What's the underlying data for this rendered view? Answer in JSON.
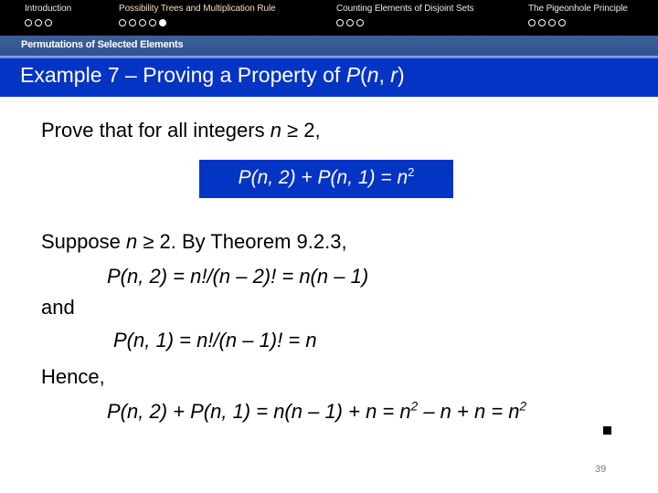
{
  "nav": {
    "sections": [
      {
        "title": "Introduction",
        "dots": [
          false,
          false,
          false
        ],
        "active": false
      },
      {
        "title": "Possibility Trees and Multiplication Rule",
        "dots": [
          false,
          false,
          false,
          false,
          true
        ],
        "active": true
      },
      {
        "title": "Counting Elements of Disjoint Sets",
        "dots": [
          false,
          false,
          false
        ],
        "active": false
      },
      {
        "title": "The Pigeonhole Principle",
        "dots": [
          false,
          false,
          false,
          false
        ],
        "active": false
      }
    ]
  },
  "subsection": "Permutations of Selected Elements",
  "slide": {
    "title_prefix": "Example 7 – Proving a Property of ",
    "title_math": "P",
    "title_math_args": "(",
    "title_n": "n",
    "title_sep": ", ",
    "title_r": "r",
    "title_close": ")",
    "intro_text": "Prove that for all integers ",
    "intro_var": "n",
    "intro_rest": " ≥ 2,",
    "boxed_formula_main": "P(n, 2) + P(n, 1) = n",
    "boxed_formula_exp": "2",
    "suppose_text": "Suppose ",
    "suppose_var": "n",
    "suppose_rest": " ≥ 2. By Theorem 9.2.3,",
    "eq1": "P(n, 2) = n!/(n – 2)! = n(n – 1)",
    "and_text": "and",
    "eq2": "P(n, 1) = n!/(n – 1)! = n",
    "hence_text": "Hence,",
    "eq3_main": "P(n, 2) + P(n, 1) = n(n – 1) + n = n",
    "eq3_exp1": "2",
    "eq3_mid": " – n + n = n",
    "eq3_exp2": "2",
    "page_number": "39"
  },
  "colors": {
    "nav_bg": "#000000",
    "subsection_bg": "#3a5c96",
    "title_bg": "#0434c4",
    "text": "#000000"
  }
}
